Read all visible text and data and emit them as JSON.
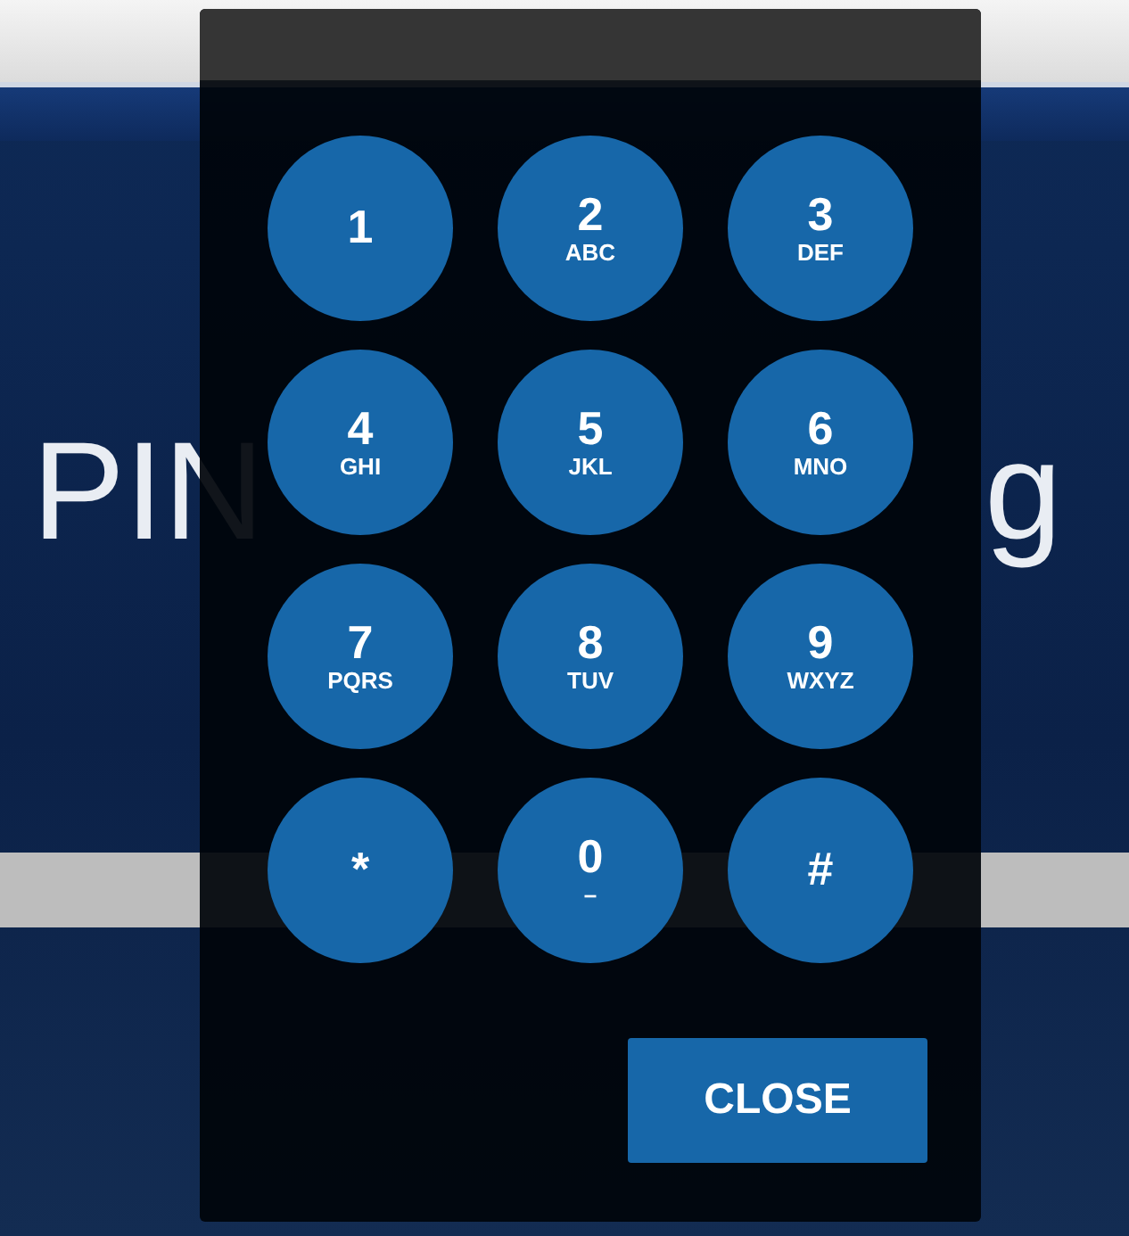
{
  "background": {
    "left_text": "PIN",
    "right_text": "g"
  },
  "keypad": {
    "keys": [
      {
        "digit": "1"
      },
      {
        "digit": "2",
        "letters": "ABC"
      },
      {
        "digit": "3",
        "letters": "DEF"
      },
      {
        "digit": "4",
        "letters": "GHI"
      },
      {
        "digit": "5",
        "letters": "JKL"
      },
      {
        "digit": "6",
        "letters": "MNO"
      },
      {
        "digit": "7",
        "letters": "PQRS"
      },
      {
        "digit": "8",
        "letters": "TUV"
      },
      {
        "digit": "9",
        "letters": "WXYZ"
      },
      {
        "digit": "*"
      },
      {
        "digit": "0",
        "letters": "–"
      },
      {
        "digit": "#"
      }
    ],
    "close_button": "CLOSE"
  }
}
